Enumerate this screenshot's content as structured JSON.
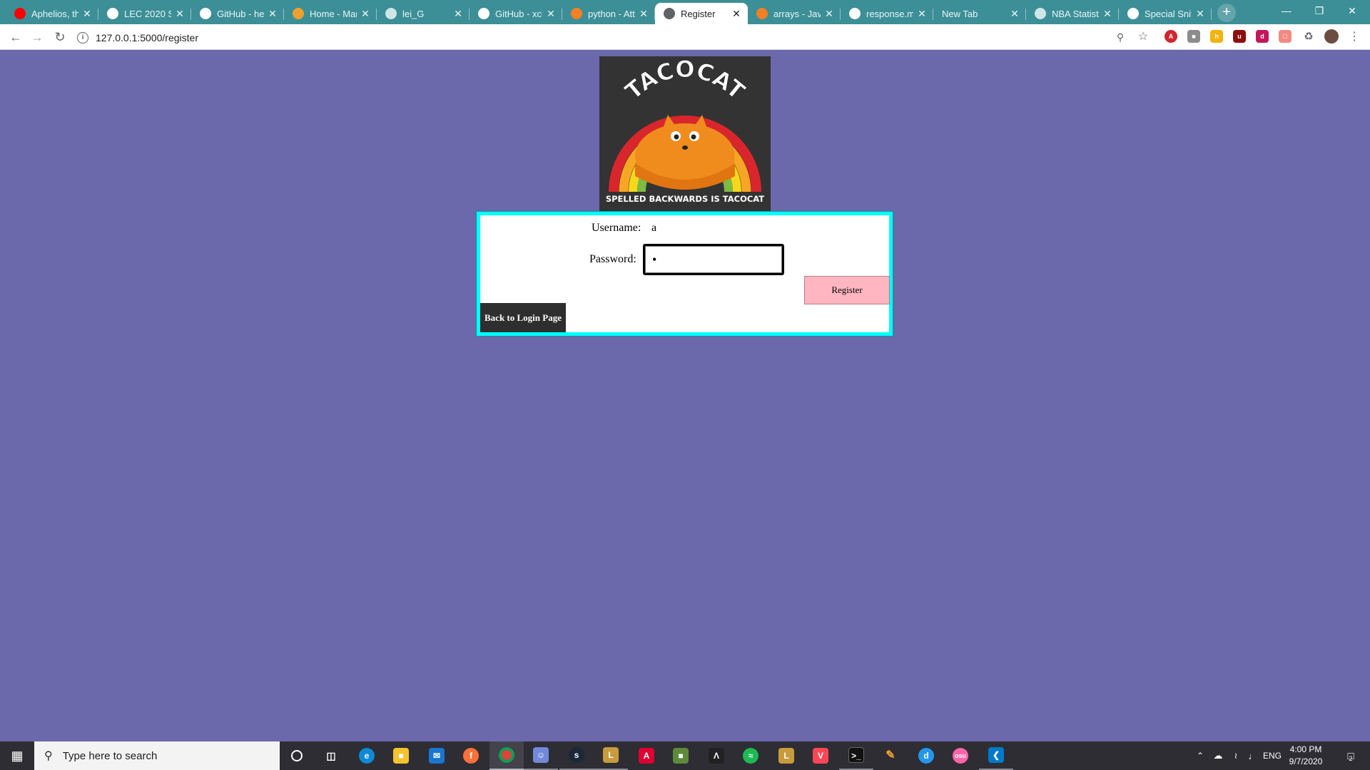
{
  "browser": {
    "tabs": [
      {
        "title": "Aphelios, th",
        "icon": "youtube-icon",
        "color": "#ff0000"
      },
      {
        "title": "LEC 2020 Su",
        "icon": "trophy-icon",
        "color": "#ffffff"
      },
      {
        "title": "GitHub - he",
        "icon": "github-icon",
        "color": "#ffffff"
      },
      {
        "title": "Home - Mar",
        "icon": "site-icon",
        "color": "#f0a030"
      },
      {
        "title": "lei_G",
        "icon": "globe-icon",
        "color": "#cfe6e8"
      },
      {
        "title": "GitHub - xch",
        "icon": "github-icon",
        "color": "#ffffff"
      },
      {
        "title": "python - Att",
        "icon": "stackoverflow-icon",
        "color": "#f48024"
      },
      {
        "title": "Register",
        "icon": "globe-icon",
        "color": "#5f6368"
      },
      {
        "title": "arrays - Java",
        "icon": "stackoverflow-icon",
        "color": "#f48024"
      },
      {
        "title": "response.ma",
        "icon": "google-icon",
        "color": "#ffffff"
      },
      {
        "title": "New Tab",
        "icon": "",
        "color": ""
      },
      {
        "title": "NBA Statisti",
        "icon": "globe-icon",
        "color": "#cfe6e8"
      },
      {
        "title": "Special Sniff",
        "icon": "github-icon",
        "color": "#ffffff"
      }
    ],
    "active_tab_index": 7,
    "url": "127.0.0.1:5000/register",
    "tab_close_glyph": "✕",
    "new_tab_glyph": "+"
  },
  "logo": {
    "title_text": "TACOCAT",
    "tagline": "SPELLED BACKWARDS IS TACOCAT"
  },
  "form": {
    "username_label": "Username:",
    "username_value": "a",
    "password_label": "Password:",
    "password_value": "a",
    "register_label": "Register",
    "back_label": "Back to Login Page"
  },
  "taskbar": {
    "search_placeholder": "Type here to search",
    "language": "ENG",
    "time": "4:00 PM",
    "date": "9/7/2020",
    "notification_count": "2"
  },
  "colors": {
    "page_background": "#6b68ab",
    "tab_strip": "#3c8f97",
    "form_border": "#00ffff",
    "register_button": "#ffb6c1",
    "back_button": "#2e2e2e"
  }
}
